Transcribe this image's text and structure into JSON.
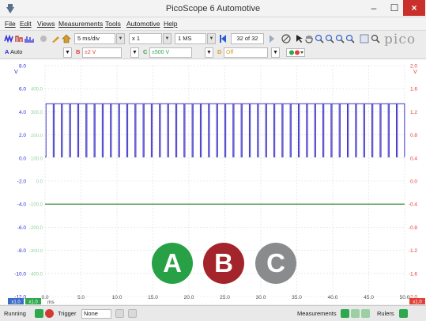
{
  "window": {
    "title": "PicoScope 6 Automotive",
    "close_glyph": "×"
  },
  "menu": [
    "File",
    "Edit",
    "Views",
    "Measurements",
    "Tools",
    "Automotive",
    "Help"
  ],
  "toolbar": {
    "timebase": "5 ms/div",
    "zoom": "x 1",
    "samples": "1 MS",
    "buffer": "32 of 32",
    "logo": "pico"
  },
  "channels": {
    "a": {
      "label": "A",
      "value": "Auto"
    },
    "b": {
      "label": "B",
      "value": "±2 V"
    },
    "c": {
      "label": "C",
      "value": "±500 V"
    },
    "d": {
      "label": "D",
      "value": "Off"
    }
  },
  "chart_data": {
    "type": "line",
    "x_unit": "ms",
    "xlim": [
      0,
      50
    ],
    "x_ticks": [
      "0.0",
      "5.0",
      "10.0",
      "15.0",
      "20.0",
      "25.0",
      "30.0",
      "35.0",
      "40.0",
      "45.0",
      "50.0"
    ],
    "left_axis": {
      "ylim": [
        -12,
        8
      ],
      "ticks": [
        "8.0",
        "6.0",
        "4.0",
        "2.0",
        "0.0",
        "-2.0",
        "-4.0",
        "-6.0",
        "-8.0",
        "-10.0",
        "-12.0"
      ],
      "unit": "V",
      "color": "#2b2bdc"
    },
    "mid_axis": {
      "ticks": [
        "400.0",
        "300.0",
        "200.0",
        "100.0",
        "0.0",
        "-100.0",
        "-200.0",
        "-300.0",
        "-400.0"
      ],
      "color": "#2ea84c"
    },
    "right_axis": {
      "ylim": [
        -2,
        2
      ],
      "ticks": [
        "2.0",
        "1.6",
        "1.2",
        "0.8",
        "0.4",
        "0.0",
        "-0.4",
        "-0.8",
        "-1.2",
        "-1.6",
        "-2.0"
      ],
      "unit": "V",
      "color": "#e0413a"
    },
    "series": [
      {
        "channel": "A",
        "color": "#3d35c8",
        "shape": "square",
        "high": 4.7,
        "low": 0.1,
        "period_ms": 1.136
      },
      {
        "channel": "B",
        "color": "#e0413a",
        "shape": "flat",
        "value": -0.4
      },
      {
        "channel": "C",
        "color": "#2ea84c",
        "shape": "flat",
        "value": -0.4
      }
    ],
    "corner_left": "x1.0",
    "corner_mid": "x1.0",
    "corner_right": "x1.0"
  },
  "badges": [
    {
      "letter": "A",
      "color": "#28a045"
    },
    {
      "letter": "B",
      "color": "#a3242a"
    },
    {
      "letter": "C",
      "color": "#8a8b8d"
    }
  ],
  "status": {
    "running": "Running",
    "trigger_label": "Trigger",
    "trigger_value": "None",
    "measurements": "Measurements",
    "rulers": "Rulers"
  }
}
